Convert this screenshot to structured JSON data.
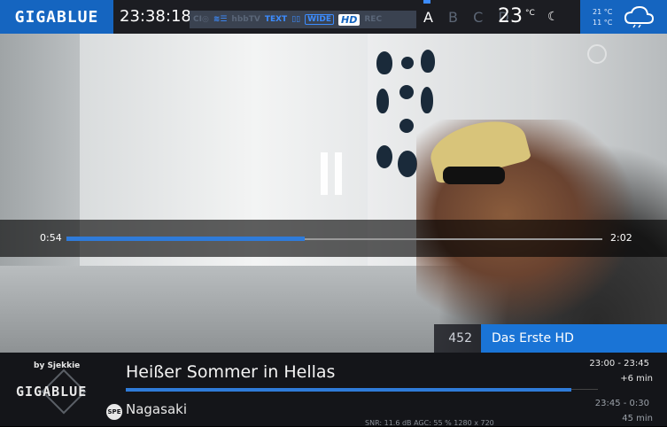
{
  "topbar": {
    "brand": "GIGABLUE",
    "clock": "23:38:18",
    "icons": [
      "ci-icon",
      "subtitle-icon",
      "hbbtv-icon",
      "teletext-icon",
      "dolby-icon",
      "widescreen-icon",
      "hd-icon",
      "rec-icon"
    ],
    "icon_labels": {
      "hbbtv": "hbbTV",
      "teletext": "TEXT",
      "wide": "WIDE",
      "hd": "HD",
      "rec": "REC"
    },
    "tuners": {
      "active": "A",
      "others": "B C D"
    },
    "temperature": "23",
    "temperature_unit": "°C",
    "weather_high": "21 °C",
    "weather_low": "11 °C"
  },
  "player": {
    "state_icon": "pause-icon",
    "position": "0:54",
    "duration": "2:02",
    "progress": 0.445
  },
  "channel": {
    "number": "452",
    "name": "Das Erste HD"
  },
  "infobar": {
    "credit": "by Sjekkie",
    "brand": "GIGABLUE",
    "badge": "SPE",
    "now": {
      "title": "Heißer Sommer in Hellas",
      "time": "23:00  -  23:45",
      "remaining": "+6 min",
      "progress": 0.945
    },
    "next": {
      "title": "Nagasaki",
      "time": "23:45  -   0:30",
      "duration": "45 min"
    },
    "signal": "SNR: 11.6 dB  AGC: 55 %      1280 x 720"
  },
  "colors": {
    "accent": "#1a74d6",
    "bar": "#1c1d22",
    "progress": "#2f7bd9"
  }
}
